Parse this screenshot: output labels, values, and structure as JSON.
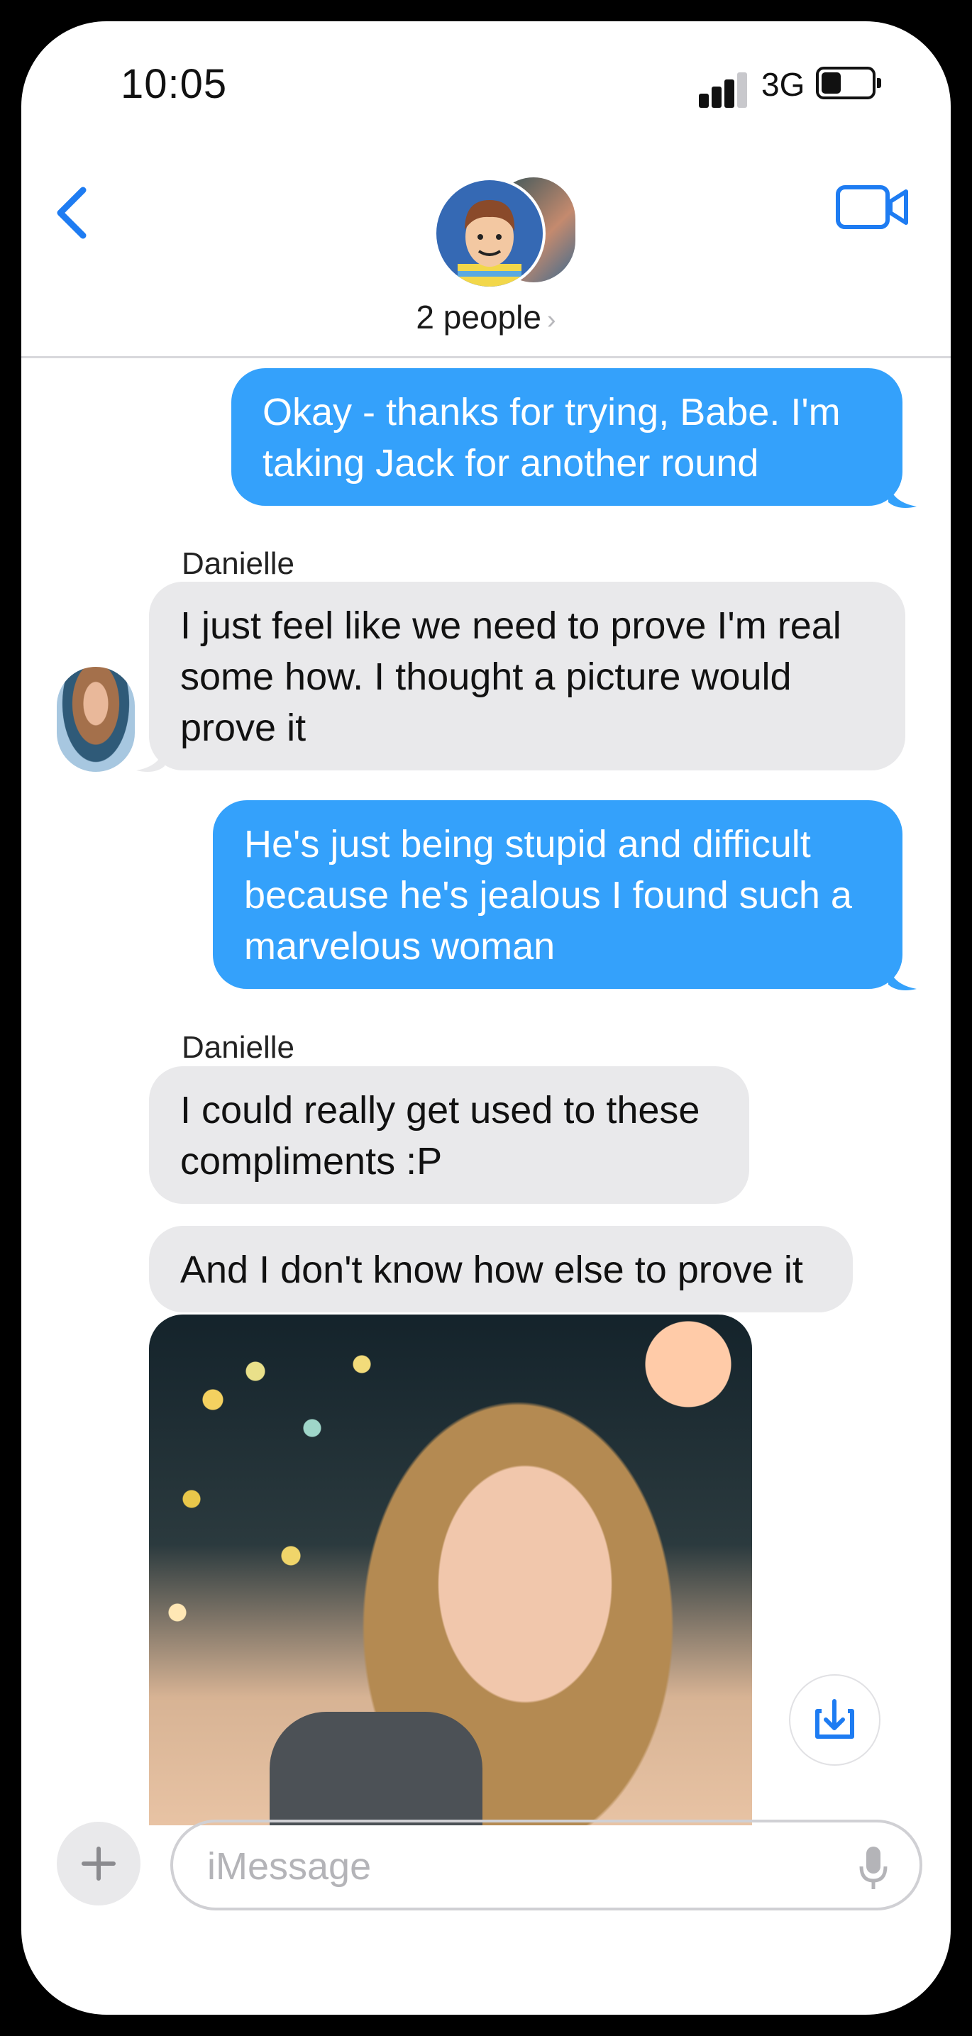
{
  "status_bar": {
    "time": "10:05",
    "network": "3G"
  },
  "header": {
    "title": "2 people",
    "title_chevron": "›",
    "back_icon": "chevron-left-icon",
    "video_icon": "video-camera-icon"
  },
  "colors": {
    "accent": "#1e7cf2",
    "outgoing": "#34a1fb",
    "incoming": "#e9e9eb"
  },
  "messages": [
    {
      "direction": "outgoing",
      "lines": [
        "Okay - thanks for trying, Babe.  I'm",
        "taking Jack for another round"
      ]
    },
    {
      "direction": "incoming",
      "sender": "Danielle",
      "lines": [
        "I just feel like we need to prove I'm real",
        "some how.  I thought a picture would",
        "prove it"
      ]
    },
    {
      "direction": "outgoing",
      "lines": [
        "He's just being stupid and difficult",
        "because he's jealous I found such a",
        "marvelous woman"
      ]
    },
    {
      "direction": "incoming",
      "sender": "Danielle",
      "lines": [
        "I could really get used to these",
        "compliments :P"
      ]
    },
    {
      "direction": "incoming",
      "lines": [
        "And I don't know how else to prove it"
      ]
    },
    {
      "direction": "incoming",
      "type": "photo",
      "save_icon": "download-icon"
    }
  ],
  "composer": {
    "placeholder": "iMessage",
    "plus_icon": "plus-icon",
    "mic_icon": "microphone-icon"
  }
}
